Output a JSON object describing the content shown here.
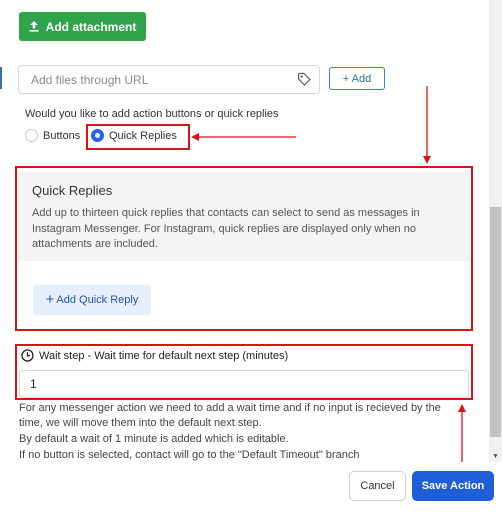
{
  "attachment": {
    "add_label": "Add attachment",
    "icon": "upload-icon"
  },
  "url_field": {
    "placeholder": "Add files through URL",
    "icon": "tag-icon",
    "add_label": "+ Add"
  },
  "action_type": {
    "question": "Would you like to add action buttons or quick replies",
    "options": [
      "Buttons",
      "Quick Replies"
    ],
    "selected": "Quick Replies"
  },
  "quick_replies": {
    "title": "Quick Replies",
    "description_lines": [
      "Add up to thirteen quick replies that contacts can select to send as messages in",
      "Instagram Messenger. For Instagram, quick replies are displayed only when no",
      "attachments are included."
    ],
    "add_label": "Add Quick Reply"
  },
  "wait_step": {
    "title": "Wait step - Wait time for default next step (minutes)",
    "value": "1",
    "help_lines": [
      "For any messenger action we need to add a wait time and if no input is recieved by the",
      "time, we will move them into the default next step.",
      "By default a wait of 1 minute is added which is editable.",
      "If no button is selected, contact will go to the \"Default Timeout\" branch"
    ]
  },
  "footer": {
    "cancel_label": "Cancel",
    "save_label": "Save Action"
  },
  "colors": {
    "accent": "#1e5ed8",
    "success": "#2fa44a",
    "annotation": "#d9131a"
  }
}
